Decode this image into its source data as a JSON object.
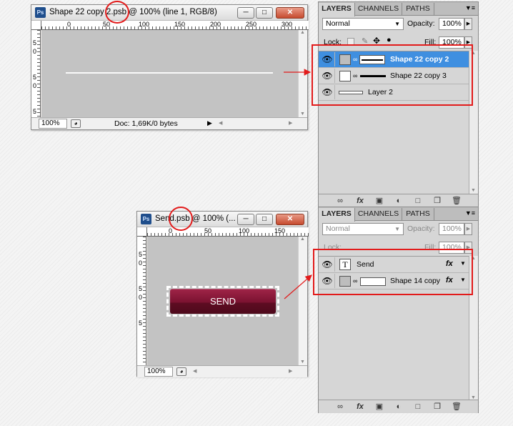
{
  "window1": {
    "title_prefix": "Shape 22 copy ",
    "title_highlight": "2.psb",
    "title_suffix": " @ 100% (line 1, RGB/8)",
    "ruler_top": [
      "0",
      "50",
      "100",
      "150",
      "200",
      "250",
      "300"
    ],
    "ruler_left": [
      "5",
      "0",
      "5",
      "0",
      "5"
    ],
    "zoom": "100%",
    "doc": "Doc: 1,69K/0 bytes"
  },
  "window2": {
    "title_prefix": "Send",
    "title_highlight": ".psb",
    "title_suffix": " @ 100% (...",
    "ruler_top": [
      "0",
      "50",
      "100",
      "150"
    ],
    "ruler_left": [
      "5",
      "0",
      "5",
      "0",
      "5"
    ],
    "zoom": "100%",
    "button_label": "SEND"
  },
  "panel1": {
    "tabs": [
      "LAYERS",
      "CHANNELS",
      "PATHS"
    ],
    "blend_mode": "Normal",
    "opacity_label": "Opacity:",
    "opacity_value": "100%",
    "lock_label": "Lock:",
    "fill_label": "Fill:",
    "fill_value": "100%",
    "layers": [
      "Shape 22 copy 2",
      "Shape 22 copy 3",
      "Layer 2"
    ]
  },
  "panel2": {
    "tabs": [
      "LAYERS",
      "CHANNELS",
      "PATHS"
    ],
    "blend_mode": "Normal",
    "opacity_label": "Opacity:",
    "opacity_value": "100%",
    "lock_label": "Lock:",
    "fill_label": "Fill:",
    "fill_value": "100%",
    "layers": [
      "Send",
      "Shape 14 copy"
    ]
  },
  "icons": [
    "photoshop-icon",
    "minimize-icon",
    "maximize-icon",
    "close-icon",
    "eye-icon",
    "chain-link-icon",
    "type-layer-icon",
    "fx-icon",
    "link-layers-icon",
    "layer-style-icon",
    "add-mask-icon",
    "adjustment-layer-icon",
    "new-group-icon",
    "new-layer-icon",
    "trash-icon",
    "panel-menu-icon"
  ],
  "colors": {
    "selected_layer": "#3f8fe0",
    "annotation_red": "#e21b1b",
    "send_button": "#7a1230"
  }
}
